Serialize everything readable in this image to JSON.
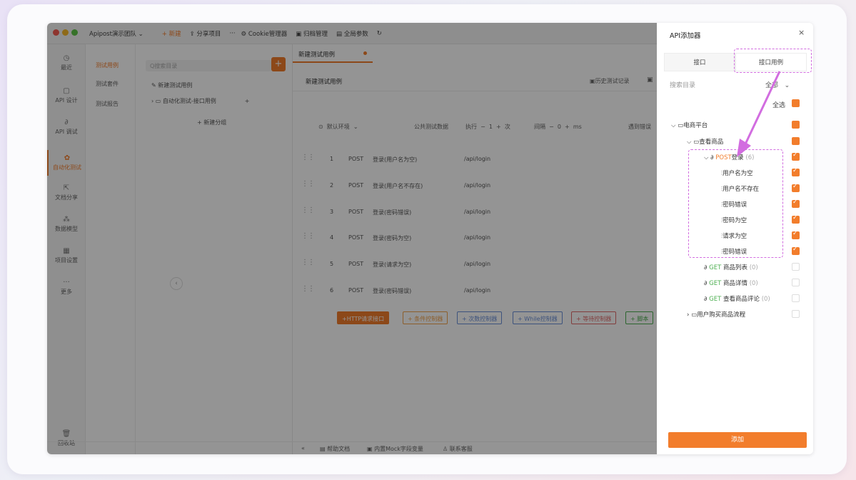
{
  "titlebar": {
    "team": "Apipost演示团队",
    "new": "+ 新建",
    "share": "分享项目",
    "more": "···",
    "cookie": "Cookie管理器",
    "archive": "归档管理",
    "global_params": "全局参数"
  },
  "nav": [
    {
      "label": "最近",
      "icon": "clock-icon"
    },
    {
      "label": "API 设计",
      "icon": "file-icon"
    },
    {
      "label": "API 调试",
      "icon": "link-icon"
    },
    {
      "label": "自动化测试",
      "icon": "automation-icon"
    },
    {
      "label": "文档分享",
      "icon": "share-icon"
    },
    {
      "label": "数据模型",
      "icon": "model-icon"
    },
    {
      "label": "项目设置",
      "icon": "settings-icon"
    },
    {
      "label": "更多",
      "icon": "more-icon"
    },
    {
      "label": "回收站",
      "icon": "trash-icon"
    }
  ],
  "subtabs": [
    "测试用例",
    "测试套件",
    "测试报告"
  ],
  "tree": {
    "search_placeholder": "Q搜索目录",
    "new_case": "新建测试用例",
    "folder": "自动化测试-接口用例",
    "new_group": "+ 新建分组"
  },
  "content": {
    "tab": "新建测试用例",
    "header_title": "新建测试用例",
    "history": "历史测试记录",
    "env": "默认环境",
    "public_data": "公共测试数据",
    "exec_label": "执行",
    "exec_value": "1",
    "times_label": "次",
    "interval_label": "间隔",
    "interval_value": "0",
    "ms": "ms",
    "on_error": "遇到错误",
    "rows": [
      {
        "idx": "1",
        "method": "POST",
        "name": "登录(用户名为空)",
        "url": "/api/login"
      },
      {
        "idx": "2",
        "method": "POST",
        "name": "登录(用户名不存在)",
        "url": "/api/login"
      },
      {
        "idx": "3",
        "method": "POST",
        "name": "登录(密码错误)",
        "url": "/api/login"
      },
      {
        "idx": "4",
        "method": "POST",
        "name": "登录(密码为空)",
        "url": "/api/login"
      },
      {
        "idx": "5",
        "method": "POST",
        "name": "登录(请求为空)",
        "url": "/api/login"
      },
      {
        "idx": "6",
        "method": "POST",
        "name": "登录(密码错误)",
        "url": "/api/login"
      }
    ],
    "controls": [
      {
        "label": "+HTTP请求接口",
        "color": "#f27d2c"
      },
      {
        "label": "+ 条件控制器",
        "color": "#f2a24a"
      },
      {
        "label": "+ 次数控制器",
        "color": "#6a8fd8"
      },
      {
        "label": "+ While控制器",
        "color": "#6a8fd8"
      },
      {
        "label": "+ 等待控制器",
        "color": "#e06a6a"
      },
      {
        "label": "+ 脚本",
        "color": "#4caf50"
      }
    ]
  },
  "bottombar": {
    "help": "帮助文档",
    "mock": "内置Mock字段变量",
    "support": "联系客服"
  },
  "panel": {
    "title": "API添加器",
    "close": "×",
    "tabs": [
      "接口",
      "接口用例"
    ],
    "search_placeholder": "搜索目录",
    "filter": "全部",
    "select_all": "全选",
    "root": "电商平台",
    "group": "查看商品",
    "login_method": "POST",
    "login_name": "登录",
    "login_count": "(6)",
    "cases": [
      "用户名为空",
      "用户名不存在",
      "密码错误",
      "密码为空",
      "请求为空",
      "密码错误"
    ],
    "apis": [
      {
        "method": "GET",
        "name": "商品列表",
        "count": "(0)"
      },
      {
        "method": "GET",
        "name": "商品详情",
        "count": "(0)"
      },
      {
        "method": "GET",
        "name": "查看商品评论",
        "count": "(0)"
      }
    ],
    "folder2": "用户购买商品流程",
    "add_button": "添加"
  }
}
